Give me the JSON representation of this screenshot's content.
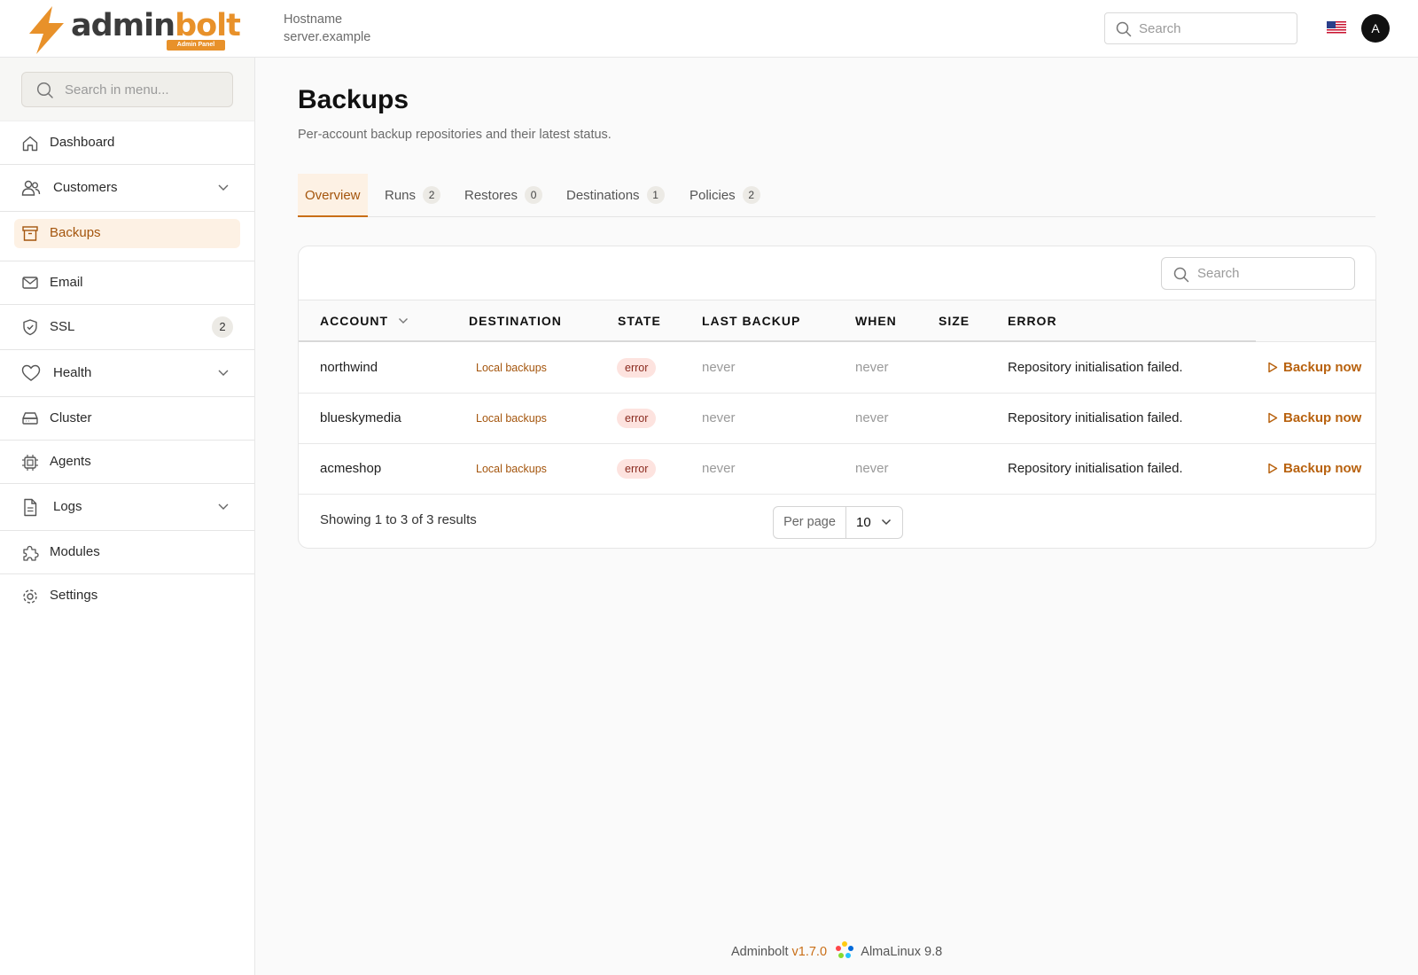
{
  "brand": {
    "name_dark": "admin",
    "name_accent": "bolt",
    "badge": "Admin Panel",
    "accent_color": "#e8912a"
  },
  "header": {
    "host_label": "Hostname",
    "host_value": "server.example",
    "search_placeholder": "Search",
    "avatar_initial": "A",
    "language_flag": "us-flag-icon"
  },
  "sidebar": {
    "search_placeholder": "Search in menu...",
    "items": [
      {
        "label": "Dashboard",
        "icon": "home-icon"
      },
      {
        "label": "Customers",
        "icon": "users-icon",
        "expandable": true
      },
      {
        "label": "Backups",
        "icon": "archive-icon",
        "active": true
      },
      {
        "label": "Email",
        "icon": "mail-icon"
      },
      {
        "label": "SSL",
        "icon": "shield-icon",
        "badge": "2"
      },
      {
        "label": "Health",
        "icon": "heart-icon",
        "expandable": true
      },
      {
        "label": "Cluster",
        "icon": "server-icon"
      },
      {
        "label": "Agents",
        "icon": "chip-icon"
      },
      {
        "label": "Logs",
        "icon": "file-icon",
        "expandable": true
      },
      {
        "label": "Modules",
        "icon": "puzzle-icon"
      },
      {
        "label": "Settings",
        "icon": "gear-icon"
      }
    ]
  },
  "page": {
    "title": "Backups",
    "subtitle": "Per-account backup repositories and their latest status."
  },
  "tabs": [
    {
      "label": "Overview",
      "active": true
    },
    {
      "label": "Runs",
      "count": "2"
    },
    {
      "label": "Restores",
      "count": "0"
    },
    {
      "label": "Destinations",
      "count": "1"
    },
    {
      "label": "Policies",
      "count": "2"
    }
  ],
  "table": {
    "search_placeholder": "Search",
    "columns": [
      "ACCOUNT",
      "DESTINATION",
      "STATE",
      "LAST BACKUP",
      "WHEN",
      "SIZE",
      "ERROR"
    ],
    "rows": [
      {
        "account": "northwind",
        "destination": "Local backups",
        "state": "error",
        "last_backup": "never",
        "when": "never",
        "size": "",
        "error": "Repository initialisation failed.",
        "action": "Backup now"
      },
      {
        "account": "blueskymedia",
        "destination": "Local backups",
        "state": "error",
        "last_backup": "never",
        "when": "never",
        "size": "",
        "error": "Repository initialisation failed.",
        "action": "Backup now"
      },
      {
        "account": "acmeshop",
        "destination": "Local backups",
        "state": "error",
        "last_backup": "never",
        "when": "never",
        "size": "",
        "error": "Repository initialisation failed.",
        "action": "Backup now"
      }
    ],
    "summary": "Showing 1 to 3 of 3 results",
    "per_page_label": "Per page",
    "per_page_value": "10"
  },
  "footer": {
    "product": "Adminbolt",
    "version": "v1.7.0",
    "os": "AlmaLinux 9.8"
  }
}
